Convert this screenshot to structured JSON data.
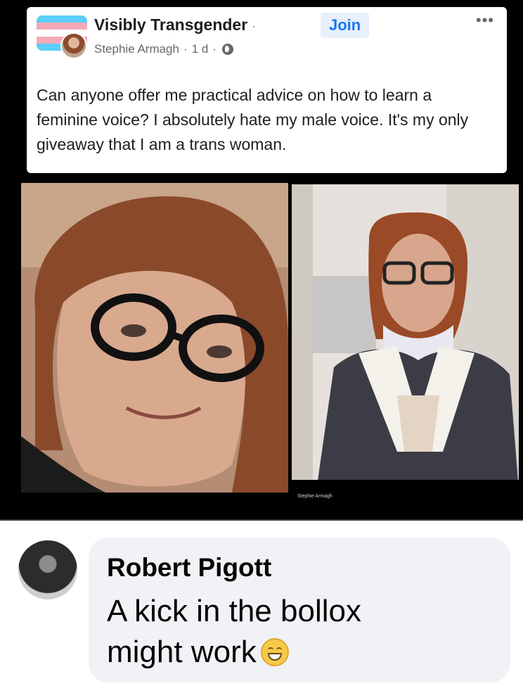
{
  "post": {
    "group_name": "Visibly Transgender",
    "join_label": "Join",
    "author": "Stephie Armagh",
    "time": "1 d",
    "text": "Can anyone offer me practical advice on how to learn a feminine voice? I absolutely hate my male voice. It's my only giveaway that I am a trans woman."
  },
  "photo_caption": {
    "name": "Stephie Armagh"
  },
  "comment": {
    "author": "Robert Pigott",
    "text": "A kick in the bollox might work"
  },
  "colors": {
    "flag_blue": "#5bcefa",
    "flag_pink": "#f5a9b8",
    "flag_white": "#ffffff",
    "link_blue": "#1877f2",
    "bubble_bg": "#f0f2f5"
  },
  "icons": {
    "more": "more-icon",
    "globe": "globe-icon",
    "emoji": "grinning-face-icon"
  }
}
